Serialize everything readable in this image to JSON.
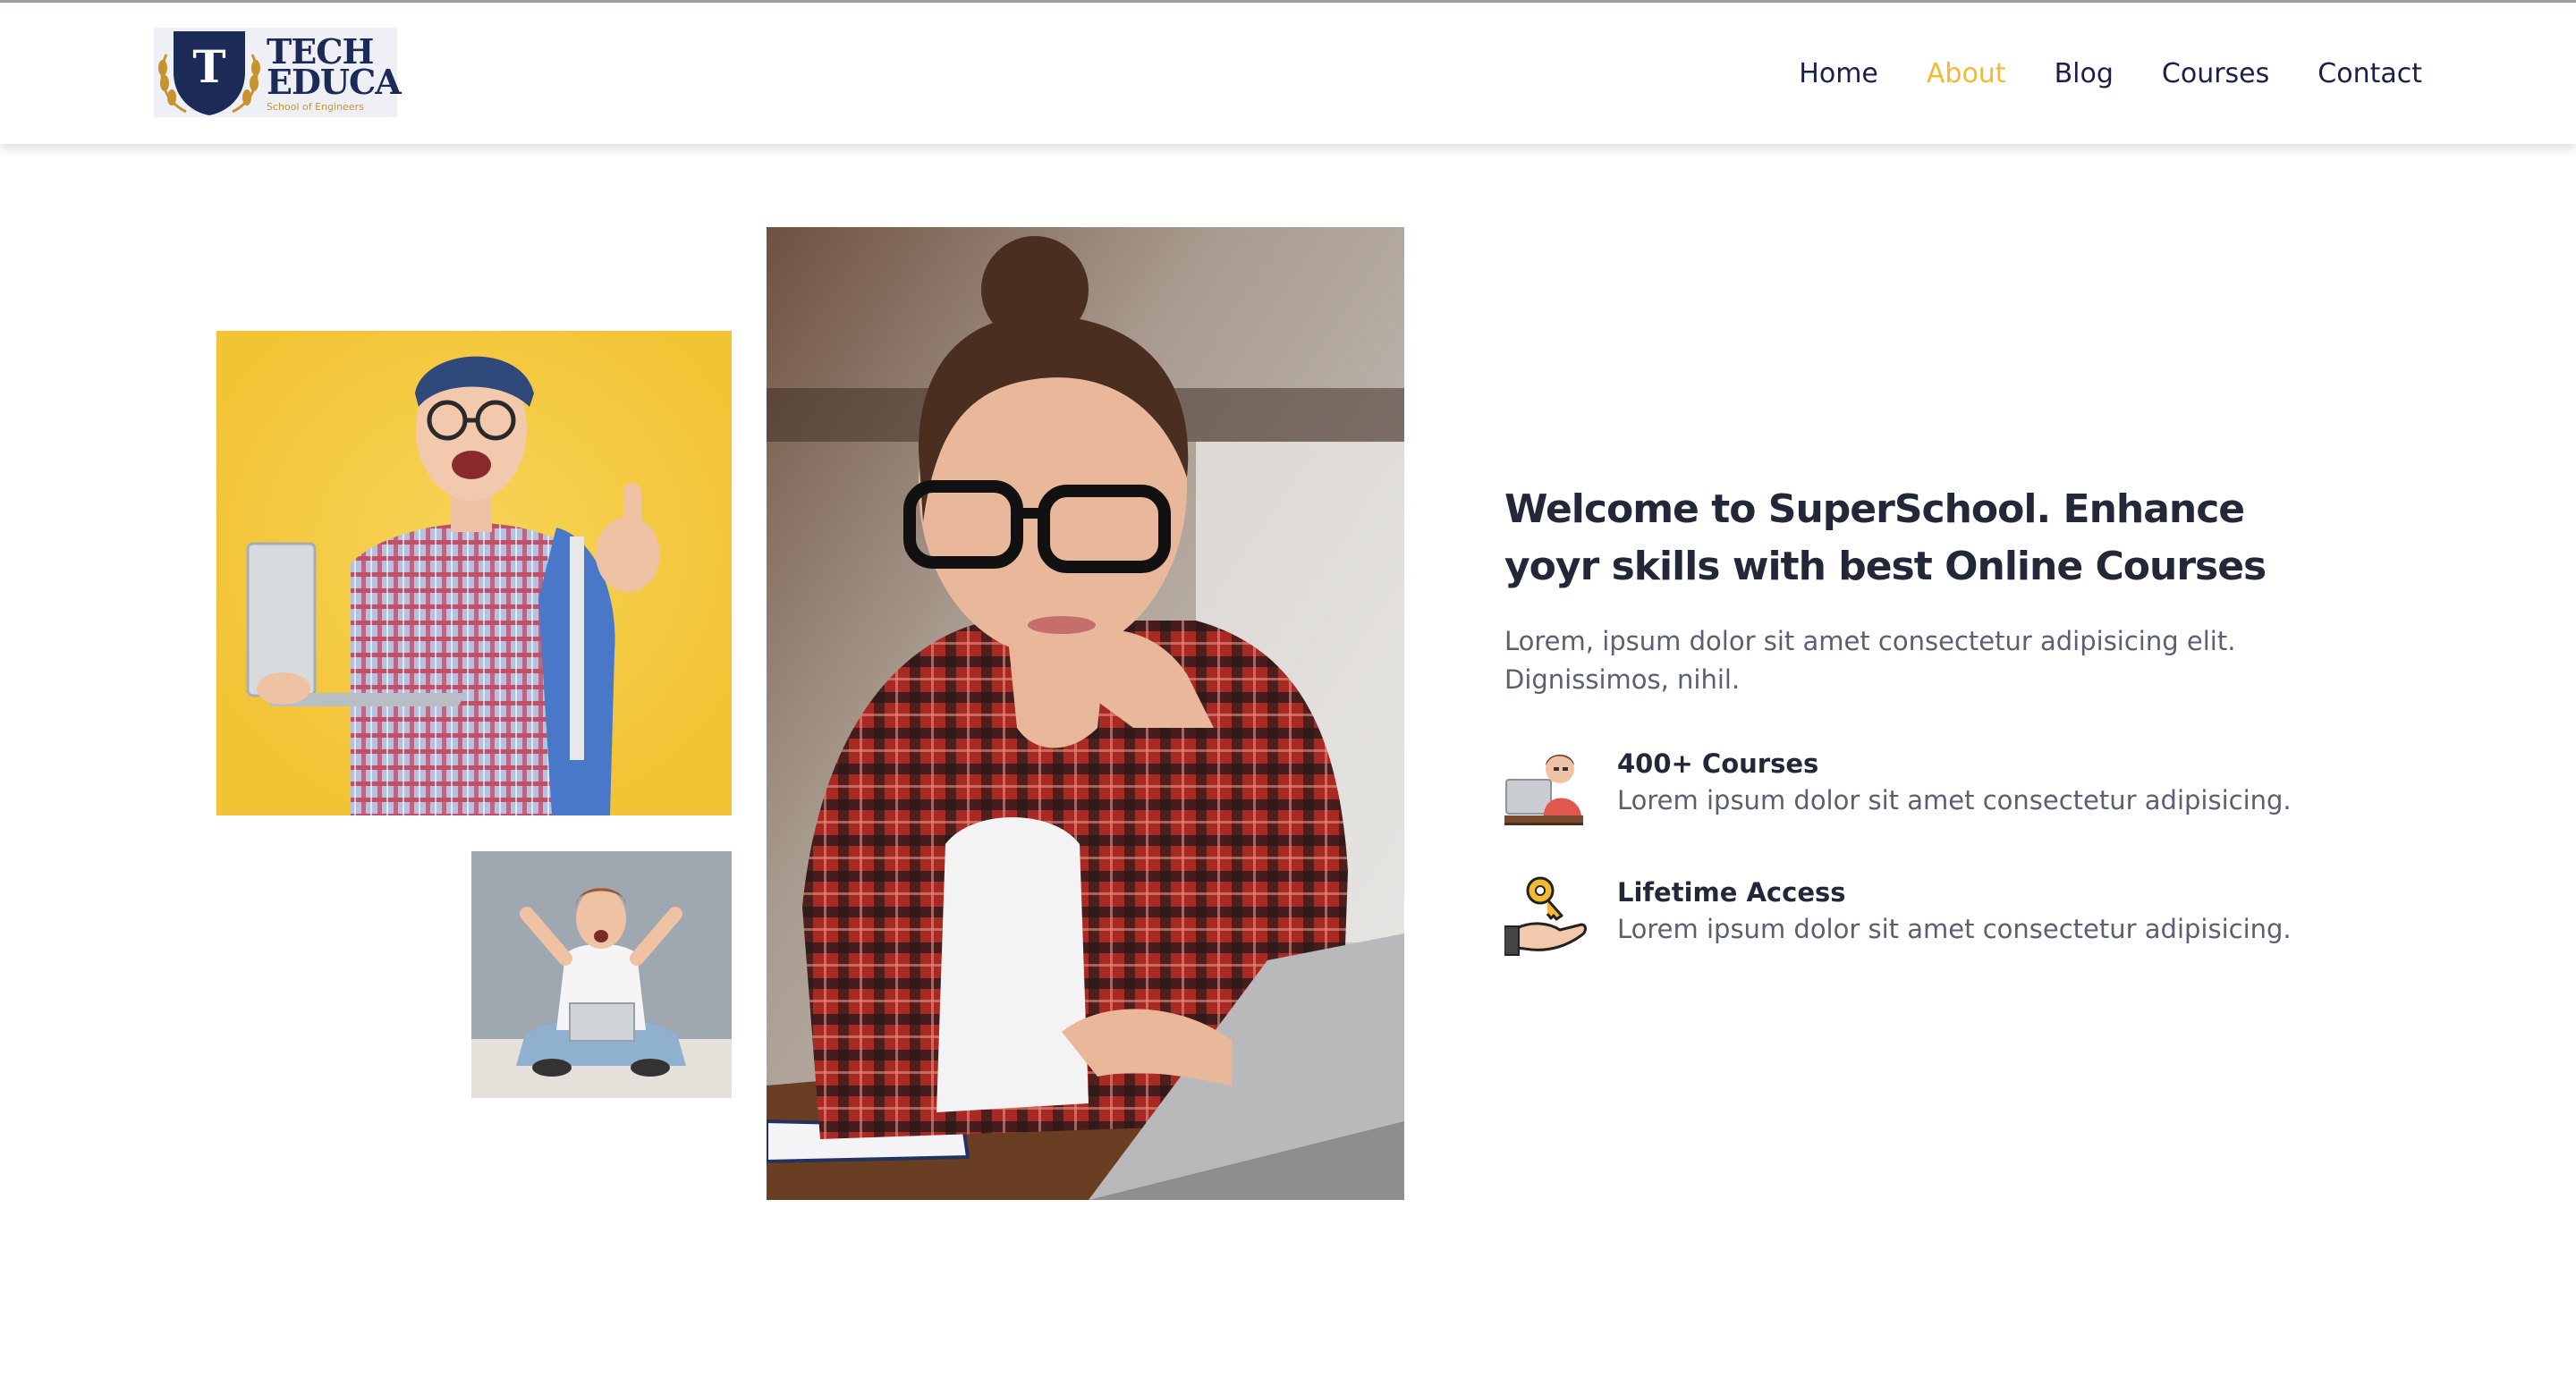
{
  "brand": {
    "logo_letter": "T",
    "logo_line1": "TECH",
    "logo_line2": "EDUCA",
    "logo_tagline": "School of Engineers"
  },
  "nav": {
    "items": [
      {
        "label": "Home",
        "active": false
      },
      {
        "label": "About",
        "active": true
      },
      {
        "label": "Blog",
        "active": false
      },
      {
        "label": "Courses",
        "active": false
      },
      {
        "label": "Contact",
        "active": false
      }
    ]
  },
  "about": {
    "heading": "Welcome to SuperSchool. Enhance yoyr skills with best Online Courses",
    "lead": "Lorem, ipsum dolor sit amet consectetur adipisicing elit. Dignissimos, nihil.",
    "features": [
      {
        "icon": "student-computer-icon",
        "title": "400+ Courses",
        "text": "Lorem ipsum dolor sit amet consectetur adipisicing."
      },
      {
        "icon": "key-in-hand-icon",
        "title": "Lifetime Access",
        "text": "Lorem ipsum dolor sit amet consectetur adipisicing."
      }
    ]
  },
  "colors": {
    "navy": "#1b1f4b",
    "accent": "#f5b931",
    "heading": "#222837",
    "body_text": "#5b6070"
  }
}
